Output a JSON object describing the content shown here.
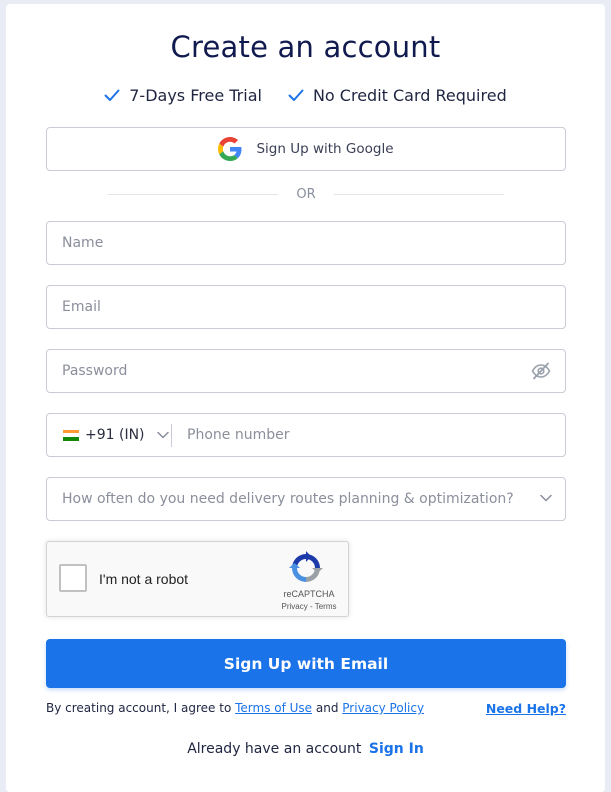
{
  "header": {
    "title": "Create an account",
    "perks": [
      "7-Days Free Trial",
      "No Credit Card Required"
    ]
  },
  "google": {
    "label": "Sign Up with Google",
    "icon": "google-icon"
  },
  "divider": {
    "label": "OR"
  },
  "form": {
    "name_placeholder": "Name",
    "email_placeholder": "Email",
    "password_placeholder": "Password",
    "country_code": "+91 (IN)",
    "phone_placeholder": "Phone number",
    "frequency_placeholder": "How often do you need delivery routes planning & optimization?"
  },
  "captcha": {
    "label": "I'm not a robot",
    "brand": "reCAPTCHA",
    "links": "Privacy - Terms"
  },
  "submit": {
    "label": "Sign Up with Email"
  },
  "footer": {
    "terms_prefix": "By creating account, I agree to ",
    "terms_link": "Terms of Use",
    "terms_and": " and ",
    "privacy_link": "Privacy Policy",
    "help": "Need Help?",
    "signin_prompt": "Already have an account",
    "signin_link": "Sign In"
  },
  "colors": {
    "accent": "#1a73e8",
    "title": "#111a4f",
    "border": "#c9ccd6"
  }
}
